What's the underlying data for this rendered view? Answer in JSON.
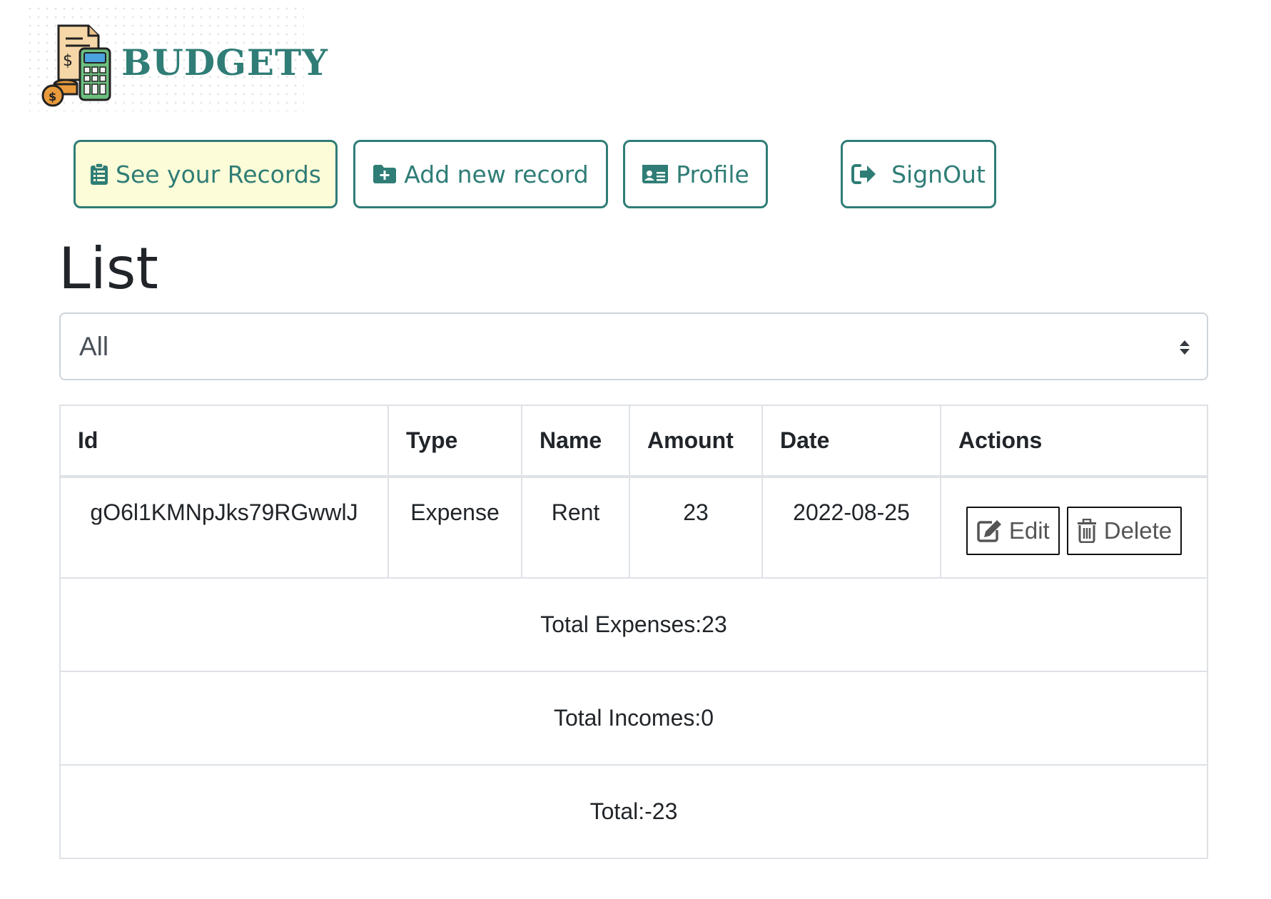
{
  "brand": {
    "name": "BUDGETY",
    "accent": "#2f7d76"
  },
  "nav": {
    "records": "See your Records",
    "add": "Add new record",
    "profile": "Profile",
    "signout": "SignOut"
  },
  "page_title": "List",
  "filter": {
    "selected": "All"
  },
  "table": {
    "headers": [
      "Id",
      "Type",
      "Name",
      "Amount",
      "Date",
      "Actions"
    ],
    "rows": [
      {
        "id": "gO6l1KMNpJks79RGwwlJ",
        "type": "Expense",
        "name": "Rent",
        "amount": "23",
        "date": "2022-08-25"
      }
    ],
    "actions": {
      "edit": "Edit",
      "delete": "Delete"
    },
    "summary": {
      "expenses": "Total Expenses:23",
      "incomes": "Total Incomes:0",
      "total": "Total:-23"
    }
  }
}
